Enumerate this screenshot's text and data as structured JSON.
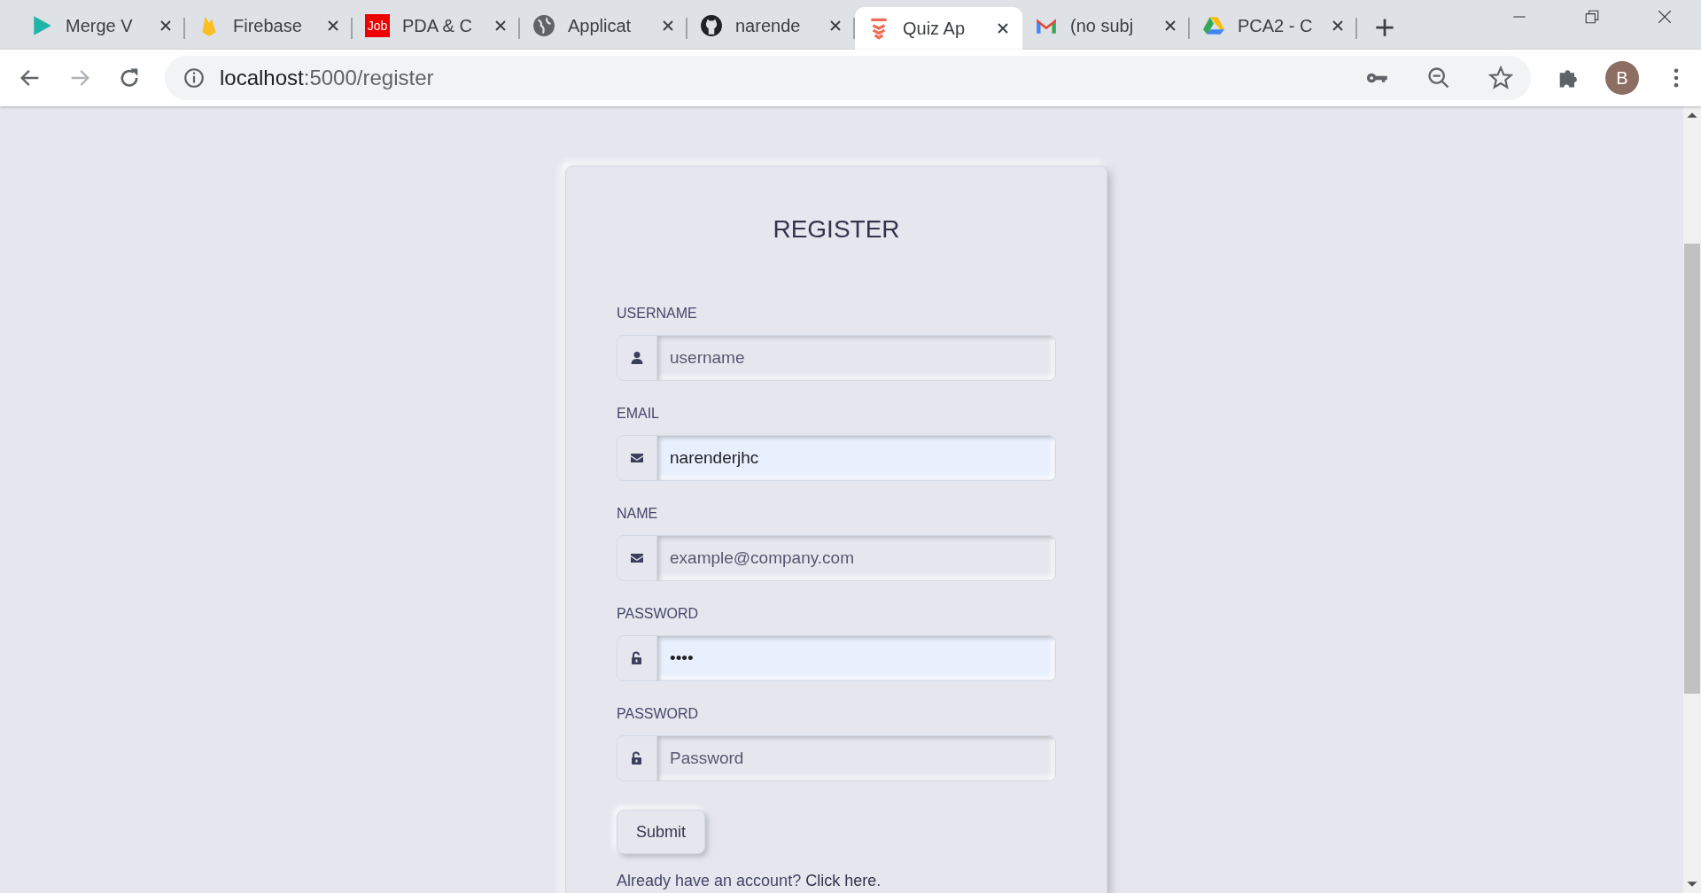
{
  "tabs": [
    {
      "title": "Merge V",
      "kind": "play",
      "selected": false
    },
    {
      "title": "Firebase",
      "kind": "flame",
      "selected": false
    },
    {
      "title": "PDA & C",
      "kind": "badge",
      "badge_text": "Job",
      "selected": false
    },
    {
      "title": "Applicat",
      "kind": "globe",
      "selected": false
    },
    {
      "title": "narende",
      "kind": "cat",
      "selected": false
    },
    {
      "title": "Quiz Ap",
      "kind": "chevrons",
      "selected": true
    },
    {
      "title": "(no subj",
      "kind": "mail",
      "selected": false
    },
    {
      "title": "PCA2 - C",
      "kind": "triangle",
      "selected": false
    }
  ],
  "address_bar": {
    "host": "localhost",
    "path": ":5000/register"
  },
  "profile": {
    "initial": "B"
  },
  "form": {
    "title": "REGISTER",
    "fields": [
      {
        "label": "USERNAME",
        "kind": "user",
        "placeholder": "username",
        "autofilled": false
      },
      {
        "label": "EMAIL",
        "kind": "mail",
        "value": "narenderjhc",
        "autofilled": true
      },
      {
        "label": "NAME",
        "kind": "mail",
        "placeholder": "example@company.com",
        "autofilled": false
      },
      {
        "label": "PASSWORD",
        "kind": "lock",
        "value": "••••",
        "autofilled": true
      },
      {
        "label": "PASSWORD",
        "kind": "lock",
        "placeholder": "Password",
        "autofilled": false
      }
    ],
    "submit": "Submit",
    "footer_text": "Already have an account?",
    "footer_link": "Click here",
    "footer_end": "."
  }
}
